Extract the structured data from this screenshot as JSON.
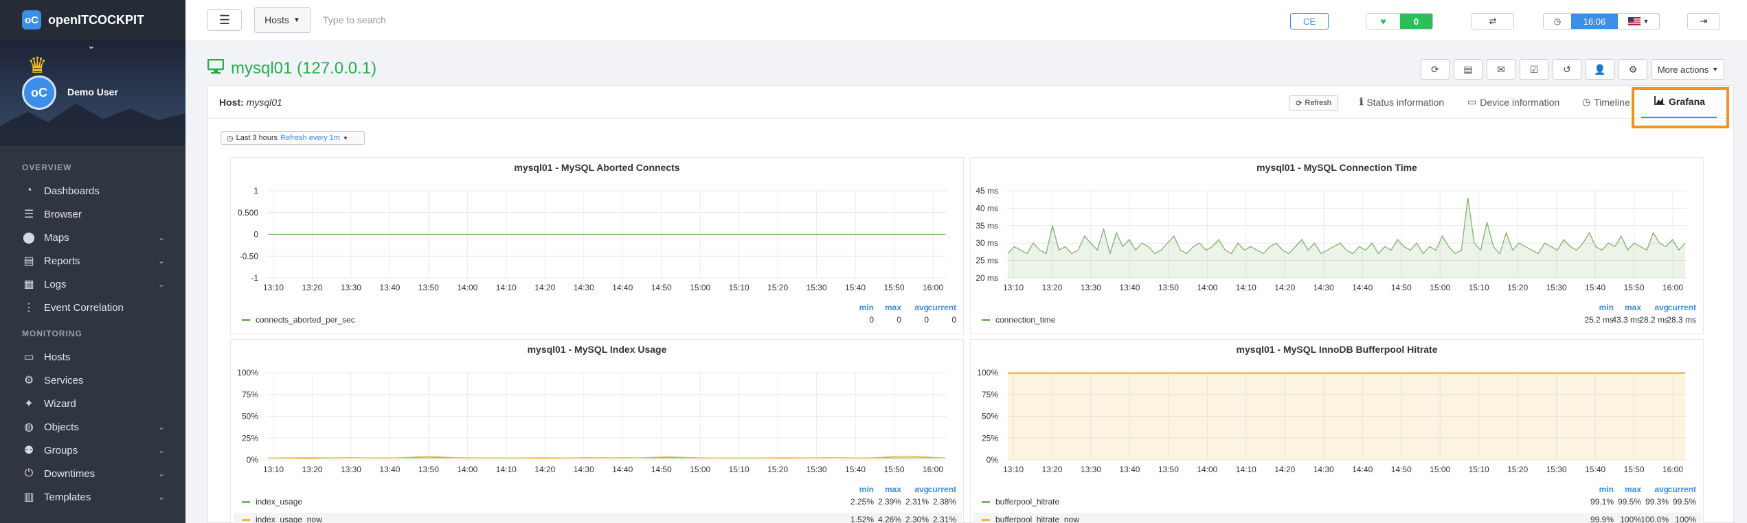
{
  "brand": {
    "logo_text": "oC",
    "name": "openITCOCKPIT"
  },
  "user": {
    "name": "Demo User",
    "avatar_text": "oC"
  },
  "nav": {
    "section_overview": "OVERVIEW",
    "section_monitoring": "MONITORING",
    "overview_items": [
      {
        "label": "Dashboards",
        "icon": "dashboard-icon",
        "has_chevron": false
      },
      {
        "label": "Browser",
        "icon": "list-icon",
        "has_chevron": false
      },
      {
        "label": "Maps",
        "icon": "map-marker-icon",
        "has_chevron": true
      },
      {
        "label": "Reports",
        "icon": "file-icon",
        "has_chevron": true
      },
      {
        "label": "Logs",
        "icon": "log-file-icon",
        "has_chevron": true
      },
      {
        "label": "Event Correlation",
        "icon": "sitemap-icon",
        "has_chevron": false
      }
    ],
    "monitoring_items": [
      {
        "label": "Hosts",
        "icon": "desktop-icon",
        "has_chevron": false
      },
      {
        "label": "Services",
        "icon": "cog-icon",
        "has_chevron": false
      },
      {
        "label": "Wizard",
        "icon": "magic-wand-icon",
        "has_chevron": false
      },
      {
        "label": "Objects",
        "icon": "globe-icon",
        "has_chevron": true
      },
      {
        "label": "Groups",
        "icon": "group-icon",
        "has_chevron": true
      },
      {
        "label": "Downtimes",
        "icon": "power-icon",
        "has_chevron": true
      },
      {
        "label": "Templates",
        "icon": "template-icon",
        "has_chevron": true
      }
    ]
  },
  "topbar": {
    "search_type": "Hosts",
    "search_placeholder": "Type to search",
    "edition": "CE",
    "health_count": "0",
    "time": "16:06"
  },
  "page": {
    "title": "mysql01 (127.0.0.1)",
    "more_actions": "More actions",
    "host_label": "Host:",
    "host_name": "mysql01",
    "refresh": "Refresh",
    "tabs": [
      "Status information",
      "Device information",
      "Timeline",
      "Grafana"
    ],
    "range_label": "Last 3 hours",
    "range_refresh": "Refresh every 1m"
  },
  "colors": {
    "green": "#7eb26d",
    "yellow": "#eab839",
    "accent": "#3d8ee8",
    "title_green": "#21b04b",
    "highlight": "#f0921e"
  },
  "legend_headers": {
    "min": "min",
    "max": "max",
    "avg": "avg",
    "current": "current"
  },
  "chart_data": [
    {
      "type": "line",
      "title": "mysql01 - MySQL Aborted Connects",
      "x": [
        "13:10",
        "13:20",
        "13:30",
        "13:40",
        "13:50",
        "14:00",
        "14:10",
        "14:20",
        "14:30",
        "14:40",
        "14:50",
        "15:00",
        "15:10",
        "15:20",
        "15:30",
        "15:40",
        "15:50",
        "16:00"
      ],
      "yticks": [
        "1",
        "0.500",
        "0",
        "-0.50",
        "-1"
      ],
      "ylim": [
        -1,
        1
      ],
      "series": [
        {
          "name": "connects_aborted_per_sec",
          "color": "#7eb26d",
          "fill": false,
          "values": [
            0,
            0,
            0,
            0,
            0,
            0,
            0,
            0,
            0,
            0,
            0,
            0,
            0,
            0,
            0,
            0,
            0,
            0
          ],
          "min": "0",
          "max": "0",
          "avg": "0",
          "current": "0"
        }
      ]
    },
    {
      "type": "area",
      "title": "mysql01 - MySQL Connection Time",
      "x": [
        "13:10",
        "13:20",
        "13:30",
        "13:40",
        "13:50",
        "14:00",
        "14:10",
        "14:20",
        "14:30",
        "14:40",
        "14:50",
        "15:00",
        "15:10",
        "15:20",
        "15:30",
        "15:40",
        "15:50",
        "16:00"
      ],
      "yticks": [
        "45 ms",
        "40 ms",
        "35 ms",
        "30 ms",
        "25 ms",
        "20 ms"
      ],
      "ylim": [
        20,
        45
      ],
      "series": [
        {
          "name": "connection_time",
          "color": "#7eb26d",
          "fill": true,
          "values": [
            27,
            29,
            28,
            27,
            30,
            28,
            27,
            35,
            28,
            29,
            27,
            28,
            32,
            30,
            28,
            34,
            27,
            33,
            29,
            31,
            28,
            30,
            29,
            27,
            28,
            30,
            32,
            28,
            27,
            29,
            30,
            28,
            29,
            31,
            28,
            27,
            30,
            28,
            29,
            28,
            27,
            29,
            30,
            28,
            27,
            29,
            31,
            28,
            30,
            27,
            28,
            29,
            30,
            28,
            27,
            29,
            28,
            30,
            27,
            29,
            28,
            31,
            29,
            28,
            30,
            27,
            29,
            28,
            32,
            29,
            27,
            28,
            43,
            30,
            28,
            36,
            29,
            27,
            33,
            28,
            30,
            29,
            28,
            27,
            30,
            29,
            28,
            31,
            29,
            28,
            30,
            33,
            29,
            28,
            30,
            29,
            32,
            28,
            30,
            29,
            28,
            33,
            30,
            29,
            31,
            28,
            30
          ],
          "min": "25.2 ms",
          "max": "43.3 ms",
          "avg": "28.2 ms",
          "current": "28.3 ms"
        }
      ]
    },
    {
      "type": "line",
      "title": "mysql01 - MySQL Index Usage",
      "x": [
        "13:10",
        "13:20",
        "13:30",
        "13:40",
        "13:50",
        "14:00",
        "14:10",
        "14:20",
        "14:30",
        "14:40",
        "14:50",
        "15:00",
        "15:10",
        "15:20",
        "15:30",
        "15:40",
        "15:50",
        "16:00"
      ],
      "yticks": [
        "100%",
        "75%",
        "50%",
        "25%",
        "0%"
      ],
      "ylim": [
        0,
        100
      ],
      "series": [
        {
          "name": "index_usage",
          "color": "#7eb26d",
          "fill": false,
          "values": [
            2.3,
            2.3,
            2.4,
            2.3,
            2.3,
            2.4,
            2.3,
            2.3,
            2.3,
            2.4,
            2.3,
            2.3,
            2.3,
            2.3,
            2.4,
            2.3,
            2.3,
            2.4
          ],
          "min": "2.25%",
          "max": "2.39%",
          "avg": "2.31%",
          "current": "2.38%"
        },
        {
          "name": "index_usage_now",
          "color": "#eab839",
          "fill": false,
          "values": [
            2.3,
            1.6,
            2.5,
            2.0,
            3.8,
            2.1,
            2.3,
            1.8,
            2.6,
            2.0,
            3.5,
            2.2,
            2.3,
            1.9,
            2.5,
            2.1,
            4.2,
            2.3
          ],
          "min": "1.52%",
          "max": "4.26%",
          "avg": "2.30%",
          "current": "2.31%"
        }
      ]
    },
    {
      "type": "area",
      "title": "mysql01 - MySQL InnoDB Bufferpool Hitrate",
      "x": [
        "13:10",
        "13:20",
        "13:30",
        "13:40",
        "13:50",
        "14:00",
        "14:10",
        "14:20",
        "14:30",
        "14:40",
        "14:50",
        "15:00",
        "15:10",
        "15:20",
        "15:30",
        "15:40",
        "15:50",
        "16:00"
      ],
      "yticks": [
        "100%",
        "75%",
        "50%",
        "25%",
        "0%"
      ],
      "ylim": [
        0,
        100
      ],
      "series": [
        {
          "name": "bufferpool_hitrate",
          "color": "#7eb26d",
          "fill": false,
          "values": [
            99.3,
            99.3,
            99.3,
            99.3,
            99.3,
            99.3,
            99.3,
            99.3,
            99.3,
            99.3,
            99.3,
            99.3,
            99.3,
            99.3,
            99.3,
            99.3,
            99.3,
            99.3
          ],
          "min": "99.1%",
          "max": "99.5%",
          "avg": "99.3%",
          "current": "99.5%"
        },
        {
          "name": "bufferpool_hitrate_now",
          "color": "#eab839",
          "fill": true,
          "values": [
            100,
            100,
            100,
            100,
            100,
            100,
            100,
            100,
            100,
            100,
            100,
            100,
            100,
            100,
            100,
            100,
            100,
            100
          ],
          "min": "99.9%",
          "max": "100%",
          "avg": "100.0%",
          "current": "100%"
        }
      ]
    }
  ]
}
